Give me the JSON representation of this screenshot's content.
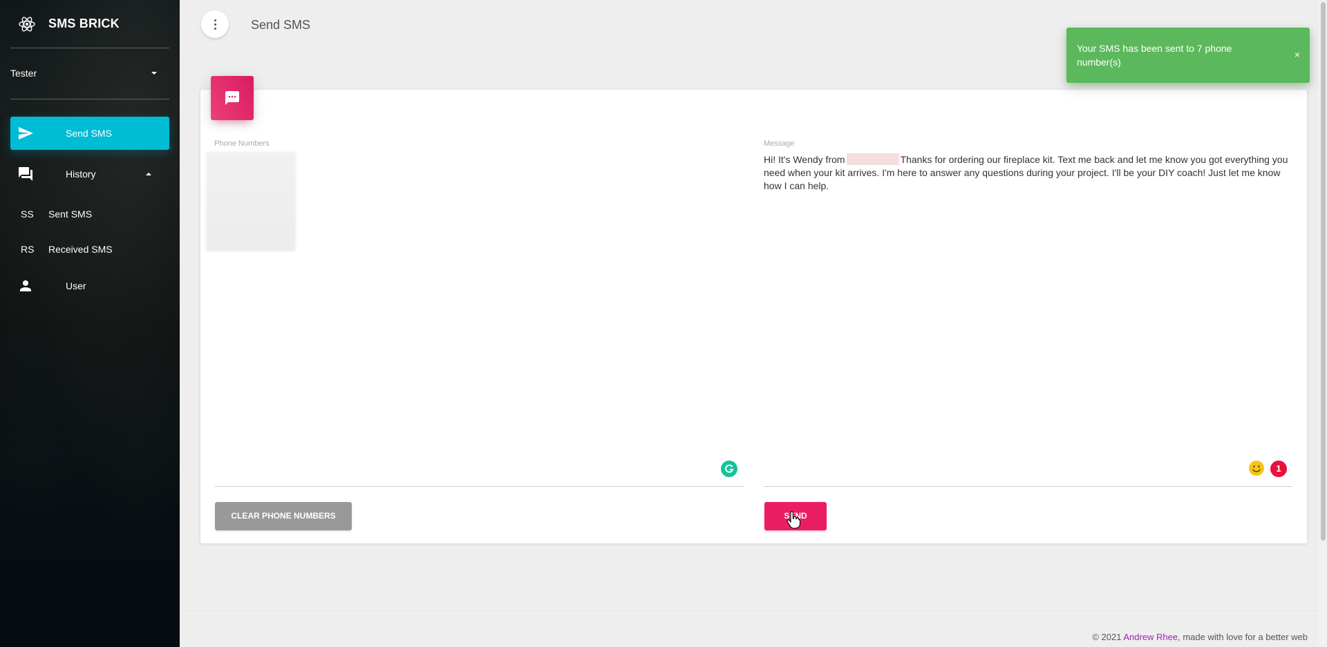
{
  "sidebar": {
    "brand": "SMS BRICK",
    "user_name": "Tester",
    "items": [
      {
        "label": "Send SMS",
        "icon": "send-icon",
        "active": true
      },
      {
        "label": "History",
        "icon": "forum-icon",
        "expanded": true
      },
      {
        "label": "User",
        "icon": "person-icon"
      }
    ],
    "history_sub": [
      {
        "abbr": "SS",
        "label": "Sent SMS"
      },
      {
        "abbr": "RS",
        "label": "Received SMS"
      }
    ]
  },
  "header": {
    "title": "Send SMS",
    "menu_icon": "more-vert-icon"
  },
  "card": {
    "icon": "sms-icon",
    "phone_label": "Phone Numbers",
    "message_label": "Message",
    "message_part1": "Hi! It's Wendy from",
    "message_part2": "Thanks for ordering our fireplace kit. Text me back and let me know you got everything you need when your kit arrives. I'm here to answer any questions during your project. I'll be your DIY coach! Just let me know how I can help.",
    "notification_count": "1",
    "clear_button": "CLEAR PHONE NUMBERS",
    "send_button": "SEND"
  },
  "toast": {
    "message": "Your SMS has been sent to 7 phone number(s)",
    "close": "×"
  },
  "footer": {
    "copyright": "© 2021",
    "author": "Andrew Rhee",
    "tagline": ", made with love for a better web"
  },
  "colors": {
    "primary": "#00bcd4",
    "accent": "#e91e63",
    "success": "#5cb85c"
  }
}
